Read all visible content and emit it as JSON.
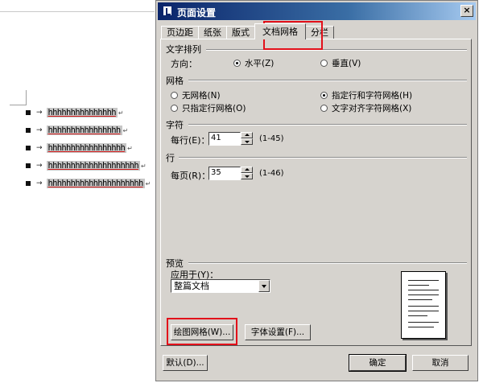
{
  "document": {
    "lines": [
      {
        "text": "hhhhhhhhhhhhhhh",
        "mark": "↵"
      },
      {
        "text": "hhhhhhhhhhhhhhhh",
        "mark": "↵"
      },
      {
        "text": "hhhhhhhhhhhhhhhhh",
        "mark": "↵"
      },
      {
        "text": "hhhhhhhhhhhhhhhhhhhh",
        "mark": "↵"
      },
      {
        "text": "hhhhhhhhhhhhhhhhhhhhh",
        "mark": "↵"
      }
    ],
    "arrow": "→"
  },
  "dialog": {
    "title": "页面设置",
    "close": "×",
    "tabs": [
      {
        "label": "页边距",
        "active": false
      },
      {
        "label": "纸张",
        "active": false
      },
      {
        "label": "版式",
        "active": false
      },
      {
        "label": "文档网格",
        "active": true
      },
      {
        "label": "分栏",
        "active": false
      }
    ],
    "text_direction": {
      "label": "文字排列",
      "direction_label": "方向：",
      "horizontal": "水平(Z)",
      "vertical": "垂直(V)"
    },
    "grid": {
      "label": "网格",
      "options": [
        {
          "label": "无网格(N)",
          "checked": false
        },
        {
          "label": "指定行和字符网格(H)",
          "checked": true
        },
        {
          "label": "只指定行网格(O)",
          "checked": false
        },
        {
          "label": "文字对齐字符网格(X)",
          "checked": false
        }
      ]
    },
    "chars": {
      "label": "字符",
      "per_line_label": "每行(E)：",
      "per_line_value": "41",
      "range": "(1-45)"
    },
    "lines": {
      "label": "行",
      "per_page_label": "每页(R)：",
      "per_page_value": "35",
      "range": "(1-46)"
    },
    "preview": {
      "label": "预览",
      "apply_to_label": "应用于(Y)：",
      "apply_to_value": "整篇文档"
    },
    "buttons": {
      "draw_grid": "绘图网格(W)...",
      "font_settings": "字体设置(F)...",
      "default": "默认(D)...",
      "ok": "确定",
      "cancel": "取消"
    },
    "colors": {
      "highlight": "#e2101a",
      "titlebar": "#0a246a",
      "face": "#d6d3ce"
    }
  }
}
